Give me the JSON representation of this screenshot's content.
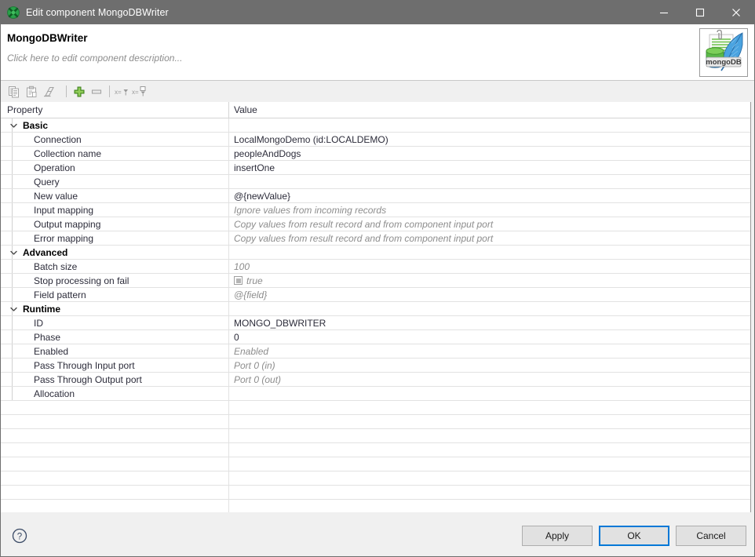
{
  "window": {
    "title": "Edit component MongoDBWriter",
    "app_icon": "clover-green-icon",
    "controls": {
      "minimize": "minimize-icon",
      "maximize": "maximize-icon",
      "close": "close-icon"
    }
  },
  "header": {
    "component_name": "MongoDBWriter",
    "description_placeholder": "Click here to edit component description...",
    "logo_text": "mongoDB",
    "logo_name": "mongodb-logo"
  },
  "toolbar": {
    "items": [
      {
        "name": "copy-icon",
        "label": "Copy",
        "enabled": false
      },
      {
        "name": "paste-icon",
        "label": "Paste",
        "enabled": false
      },
      {
        "name": "clear-icon",
        "label": "Clear",
        "enabled": false
      },
      {
        "name": "add-icon",
        "label": "Add",
        "enabled": true
      },
      {
        "name": "remove-icon",
        "label": "Remove",
        "enabled": false
      },
      {
        "name": "show-value-icon",
        "label": "Show value",
        "enabled": false
      },
      {
        "name": "show-resolved-value-icon",
        "label": "Show resolved value",
        "enabled": false
      }
    ]
  },
  "table": {
    "columns": [
      "Property",
      "Value"
    ],
    "empty_row_count": 9,
    "rows": [
      {
        "type": "group",
        "property": "Basic",
        "value": "",
        "expanded": true
      },
      {
        "type": "item",
        "property": "Connection",
        "value": "LocalMongoDemo (id:LOCALDEMO)",
        "style": "normal"
      },
      {
        "type": "item",
        "property": "Collection name",
        "value": "peopleAndDogs",
        "style": "normal"
      },
      {
        "type": "item",
        "property": "Operation",
        "value": "insertOne",
        "style": "normal"
      },
      {
        "type": "item",
        "property": "Query",
        "value": "",
        "style": "normal"
      },
      {
        "type": "item",
        "property": "New value",
        "value": "@{newValue}",
        "style": "normal"
      },
      {
        "type": "item",
        "property": "Input mapping",
        "value": "Ignore values from incoming records",
        "style": "hint"
      },
      {
        "type": "item",
        "property": "Output mapping",
        "value": "Copy values from result record and from component input port",
        "style": "hint"
      },
      {
        "type": "item",
        "property": "Error mapping",
        "value": "Copy values from result record and from component input port",
        "style": "hint"
      },
      {
        "type": "group",
        "property": "Advanced",
        "value": "",
        "expanded": true
      },
      {
        "type": "item",
        "property": "Batch size",
        "value": "100",
        "style": "hint"
      },
      {
        "type": "item",
        "property": "Stop processing on fail",
        "value": "true",
        "style": "hint",
        "checkbox": true
      },
      {
        "type": "item",
        "property": "Field pattern",
        "value": "@{field}",
        "style": "hint"
      },
      {
        "type": "group",
        "property": "Runtime",
        "value": "",
        "expanded": true
      },
      {
        "type": "item",
        "property": "ID",
        "value": "MONGO_DBWRITER",
        "style": "normal"
      },
      {
        "type": "item",
        "property": "Phase",
        "value": "0",
        "style": "normal"
      },
      {
        "type": "item",
        "property": "Enabled",
        "value": "Enabled",
        "style": "hint"
      },
      {
        "type": "item",
        "property": "Pass Through Input port",
        "value": "Port 0 (in)",
        "style": "hint"
      },
      {
        "type": "item",
        "property": "Pass Through Output port",
        "value": "Port 0 (out)",
        "style": "hint"
      },
      {
        "type": "item",
        "property": "Allocation",
        "value": "",
        "style": "normal"
      }
    ]
  },
  "footer": {
    "help_icon": "help-icon",
    "buttons": [
      {
        "name": "apply-button",
        "label": "Apply",
        "focused": false
      },
      {
        "name": "ok-button",
        "label": "OK",
        "focused": true
      },
      {
        "name": "cancel-button",
        "label": "Cancel",
        "focused": false
      }
    ]
  },
  "colors": {
    "titlebar_bg": "#6e6e6e",
    "panel_bg": "#f0f0f0",
    "accent_focus": "#0078d7",
    "accent_green": "#5aa832",
    "text_hint": "#8d8d8d"
  }
}
